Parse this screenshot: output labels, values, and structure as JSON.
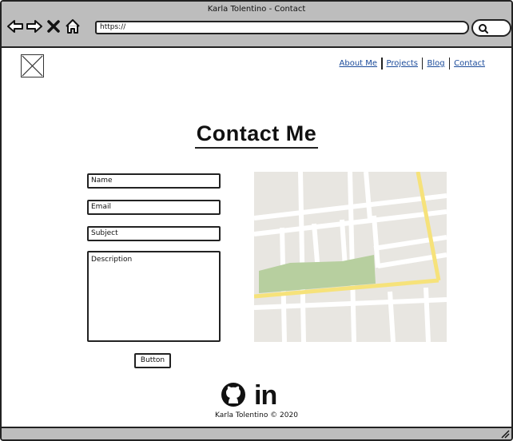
{
  "window": {
    "title": "Karla Tolentino - Contact",
    "url": "https://"
  },
  "nav": {
    "items": [
      {
        "label": "About Me"
      },
      {
        "label": "Projects"
      },
      {
        "label": "Blog"
      },
      {
        "label": "Contact"
      }
    ]
  },
  "main": {
    "title": "Contact Me",
    "form": {
      "name_placeholder": "Name",
      "email_placeholder": "Email",
      "subject_placeholder": "Subject",
      "description_placeholder": "Description",
      "button_label": "Button"
    }
  },
  "footer": {
    "icons": [
      "github-icon",
      "linkedin-icon"
    ],
    "linkedin_text": "in",
    "copyright": "Karla Tolentino © 2020"
  },
  "colors": {
    "chrome": "#bdbdbd",
    "link": "#1a4a9a",
    "map_bg": "#e8e6e1",
    "map_road_yellow": "#f6e27a",
    "map_park": "#b7cf9f"
  }
}
